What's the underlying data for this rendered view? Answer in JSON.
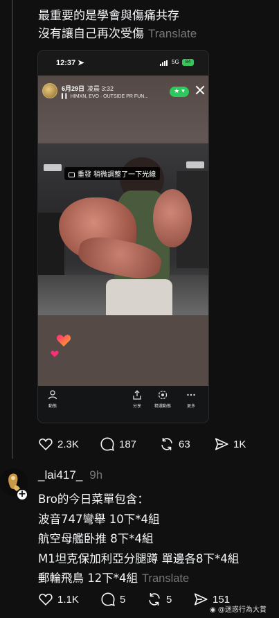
{
  "post": {
    "caption_lines": [
      "最重要的是學會與傷痛共存",
      "沒有讓自己再次受傷"
    ],
    "translate_label": "Translate",
    "stats": {
      "likes": "2.3K",
      "comments": "187",
      "reposts": "63",
      "shares": "1K"
    }
  },
  "screenshot": {
    "status_time": "12:37",
    "status_network": "5G",
    "status_battery": "84",
    "story_date": "6月29日",
    "story_time": "凌晨 3:32",
    "story_music": "HIMXN, EVO · OUTSIDE PR FUN...",
    "story_text": "重發 稍微調整了一下光線",
    "nav": [
      {
        "label": "動態",
        "icon": "activity-icon"
      },
      {
        "label": "分享",
        "icon": "share-icon"
      },
      {
        "label": "精選動態",
        "icon": "highlight-icon"
      },
      {
        "label": "更多",
        "icon": "more-icon"
      }
    ]
  },
  "reply": {
    "username": "_lai417_",
    "time": "9h",
    "lines": [
      "Bro的今日菜單包含：",
      "波音747彎舉 10下*4組",
      "航空母艦卧推 8下*4組",
      "M1坦克保加利亞分腿蹲 單邊各8下*4組",
      "郵輪飛鳥 12下*4組"
    ],
    "translate_label": "Translate",
    "stats": {
      "likes": "1.1K",
      "comments": "5",
      "reposts": "5",
      "shares": "151"
    }
  },
  "watermark": "@迷惑行為大賞",
  "colors": {
    "background": "#101010",
    "text": "#f3f5f7",
    "muted": "#777777",
    "accent_green": "#2ec95c"
  }
}
